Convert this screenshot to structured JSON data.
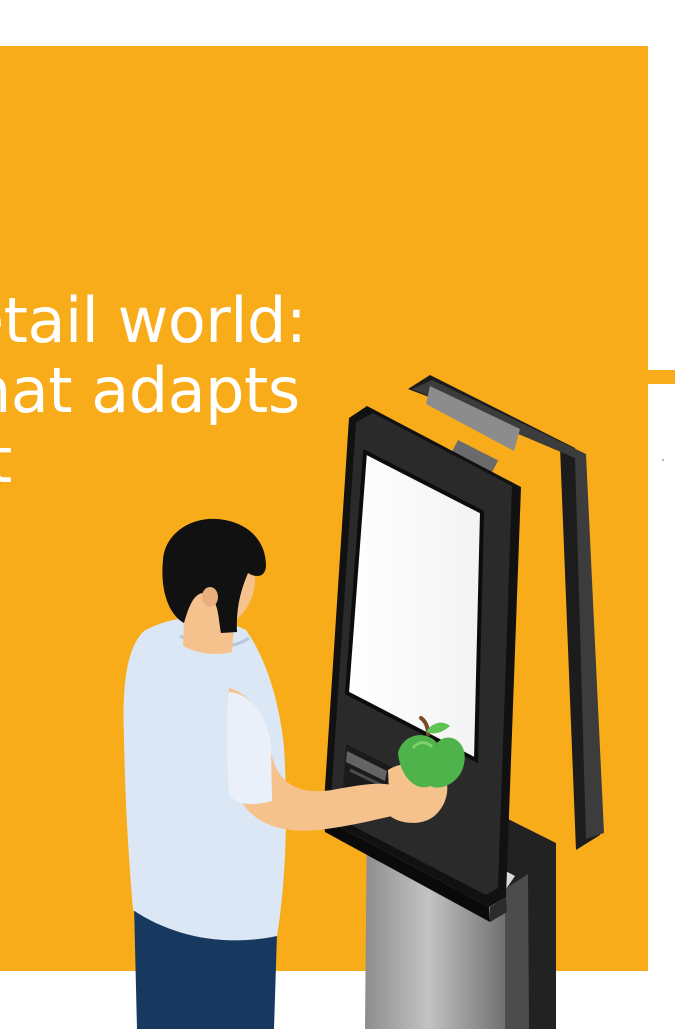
{
  "headline": {
    "line1": "etail world:",
    "line2": "hat adapts",
    "line3": "t"
  },
  "colors": {
    "panel_orange": "#F8AC1A",
    "text_white": "#FFFFFF",
    "kiosk_black": "#171717",
    "shirt_blue": "#DCE7F5",
    "jeans_navy": "#17385F",
    "apple_green": "#4DB34A"
  },
  "icons": {
    "illustration": "self-checkout-kiosk-illustration",
    "person": "shopper-illustration",
    "apple": "apple-icon"
  }
}
